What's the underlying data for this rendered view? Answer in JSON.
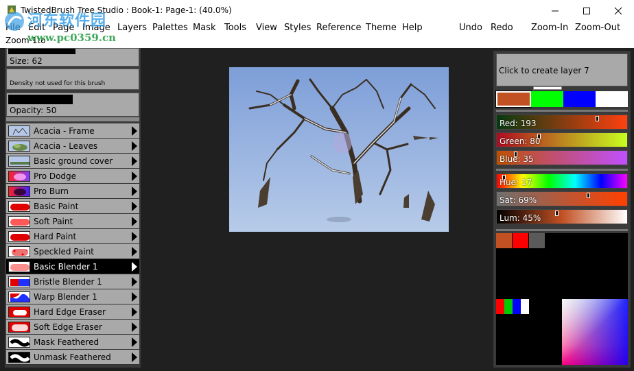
{
  "window": {
    "title": "TwistedBrush Tree Studio : Book-1: Page-1:  (40.0%)"
  },
  "menu": {
    "items": [
      "File",
      "Edit",
      "Page",
      "Image",
      "Layers",
      "Palettes",
      "Mask",
      "Tools",
      "View",
      "Styles",
      "Reference",
      "Theme",
      "Help"
    ],
    "actions": [
      "Undo",
      "Redo",
      "Zoom-In",
      "Zoom-Out"
    ],
    "zoom_1to": "Zoom-1to"
  },
  "watermark": {
    "line1": "河东软件园",
    "line2": "www.pc0359.cn"
  },
  "brush_settings": {
    "size_label": "Size: 62",
    "density_label": "Density not used for this brush",
    "opacity_label": "Opacity: 50"
  },
  "brushes": [
    {
      "name": "Acacia - Frame",
      "thumb": "acacia-frame"
    },
    {
      "name": "Acacia - Leaves",
      "thumb": "acacia-leaves"
    },
    {
      "name": "Basic ground cover",
      "thumb": "ground-cover"
    },
    {
      "name": "Pro Dodge",
      "thumb": "pro-dodge"
    },
    {
      "name": "Pro Burn",
      "thumb": "pro-burn"
    },
    {
      "name": "Basic Paint",
      "thumb": "basic-paint"
    },
    {
      "name": "Soft Paint",
      "thumb": "soft-paint"
    },
    {
      "name": "Hard Paint",
      "thumb": "hard-paint"
    },
    {
      "name": "Speckled Paint",
      "thumb": "speckled-paint"
    },
    {
      "name": "Basic Blender 1",
      "thumb": "basic-blender",
      "selected": true
    },
    {
      "name": "Bristle Blender 1",
      "thumb": "bristle-blender"
    },
    {
      "name": "Warp Blender 1",
      "thumb": "warp-blender"
    },
    {
      "name": "Hard Edge Eraser",
      "thumb": "hard-edge-eraser"
    },
    {
      "name": "Soft Edge Eraser",
      "thumb": "soft-edge-eraser"
    },
    {
      "name": "Mask Feathered",
      "thumb": "mask-feathered"
    },
    {
      "name": "Unmask Feathered",
      "thumb": "unmask-feathered"
    }
  ],
  "layers": {
    "create_label": "Click to create layer 7"
  },
  "colors": {
    "current": "#c15023",
    "swatches": [
      "#c15023",
      "#00ff00",
      "#0000ff",
      "#ffffff"
    ],
    "red_label": "Red: 193",
    "green_label": "Green: 80",
    "blue_label": "Blue: 35",
    "hue_label": "Hue: 17",
    "sat_label": "Sat: 69%",
    "lum_label": "Lum: 45%",
    "red": 193,
    "green": 80,
    "blue": 35,
    "hue": 17,
    "sat": 69,
    "lum": 45
  },
  "palette": {
    "recent": [
      "#c15023",
      "#ff0000",
      "#5a5a5a"
    ],
    "mini": [
      "#ff0000",
      "#00cc00",
      "#0000ff",
      "#ffffff"
    ]
  }
}
